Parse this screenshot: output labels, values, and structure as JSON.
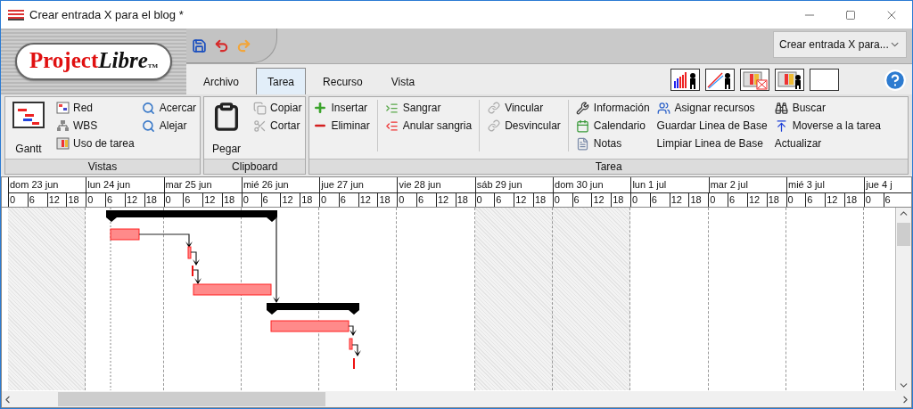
{
  "window": {
    "title": "Crear entrada X para el blog *"
  },
  "logo": {
    "main": "Project",
    "accent": "Libre",
    "mark": "TM"
  },
  "project_selector": {
    "value": "Crear entrada X para..."
  },
  "tabs": [
    {
      "label": "Archivo",
      "selected": false
    },
    {
      "label": "Tarea",
      "selected": true
    },
    {
      "label": "Recurso",
      "selected": false
    },
    {
      "label": "Vista",
      "selected": false
    }
  ],
  "ribbon": {
    "groups": [
      {
        "label": "Vistas",
        "columns": [
          {
            "separator_after": false,
            "items": [
              {
                "label": "Gantt",
                "kind": "large"
              }
            ]
          },
          {
            "separator_after": false,
            "items": [
              {
                "label": "Red",
                "kind": "small"
              },
              {
                "label": "WBS",
                "kind": "small"
              },
              {
                "label": "Uso de tarea",
                "kind": "small"
              }
            ]
          },
          {
            "separator_after": false,
            "items": [
              {
                "label": "Acercar",
                "kind": "small"
              },
              {
                "label": "Alejar",
                "kind": "small"
              }
            ]
          }
        ]
      },
      {
        "label": "Clipboard",
        "columns": [
          {
            "separator_after": false,
            "items": [
              {
                "label": "Pegar",
                "kind": "large"
              }
            ]
          },
          {
            "separator_after": false,
            "items": [
              {
                "label": "Copiar",
                "kind": "small"
              },
              {
                "label": "Cortar",
                "kind": "small"
              }
            ]
          }
        ]
      },
      {
        "label": "Tarea",
        "columns": [
          {
            "separator_after": true,
            "items": [
              {
                "label": "Insertar",
                "kind": "small"
              },
              {
                "label": "Eliminar",
                "kind": "small"
              }
            ]
          },
          {
            "separator_after": true,
            "items": [
              {
                "label": "Sangrar",
                "kind": "small"
              },
              {
                "label": "Anular sangria",
                "kind": "small"
              }
            ]
          },
          {
            "separator_after": true,
            "items": [
              {
                "label": "Vincular",
                "kind": "small"
              },
              {
                "label": "Desvincular",
                "kind": "small"
              }
            ]
          },
          {
            "separator_after": false,
            "items": [
              {
                "label": "Información",
                "kind": "small"
              },
              {
                "label": "Calendario",
                "kind": "small"
              },
              {
                "label": "Notas",
                "kind": "small"
              }
            ]
          },
          {
            "separator_after": false,
            "items": [
              {
                "label": "Asignar recursos",
                "kind": "small"
              },
              {
                "label": "Guardar Linea de Base",
                "kind": "small"
              },
              {
                "label": "Limpiar Linea de Base",
                "kind": "small"
              }
            ]
          },
          {
            "separator_after": false,
            "items": [
              {
                "label": "Buscar",
                "kind": "small"
              },
              {
                "label": "Moverse a la tarea",
                "kind": "small"
              },
              {
                "label": "Actualizar",
                "kind": "small"
              }
            ]
          }
        ]
      }
    ]
  },
  "timeline": {
    "days": [
      {
        "label": "dom 23 jun",
        "weekend": true,
        "hours": [
          "0",
          "6",
          "12",
          "18"
        ]
      },
      {
        "label": "lun 24 jun",
        "weekend": false,
        "hours": [
          "0",
          "6",
          "12",
          "18"
        ]
      },
      {
        "label": "mar 25 jun",
        "weekend": false,
        "hours": [
          "0",
          "6",
          "12",
          "18"
        ]
      },
      {
        "label": "mié 26 jun",
        "weekend": false,
        "hours": [
          "0",
          "6",
          "12",
          "18"
        ]
      },
      {
        "label": "jue 27 jun",
        "weekend": false,
        "hours": [
          "0",
          "6",
          "12",
          "18"
        ]
      },
      {
        "label": "vie 28 jun",
        "weekend": false,
        "hours": [
          "0",
          "6",
          "12",
          "18"
        ]
      },
      {
        "label": "sáb 29 jun",
        "weekend": true,
        "hours": [
          "0",
          "6",
          "12",
          "18"
        ]
      },
      {
        "label": "dom 30 jun",
        "weekend": true,
        "hours": [
          "0",
          "6",
          "12",
          "18"
        ]
      },
      {
        "label": "lun 1 jul",
        "weekend": false,
        "hours": [
          "0",
          "6",
          "12",
          "18"
        ]
      },
      {
        "label": "mar 2 jul",
        "weekend": false,
        "hours": [
          "0",
          "6",
          "12",
          "18"
        ]
      },
      {
        "label": "mié 3 jul",
        "weekend": false,
        "hours": [
          "0",
          "6",
          "12",
          "18"
        ]
      },
      {
        "label": "jue 4 j",
        "weekend": false,
        "hours": [
          "0",
          "6"
        ]
      }
    ]
  }
}
